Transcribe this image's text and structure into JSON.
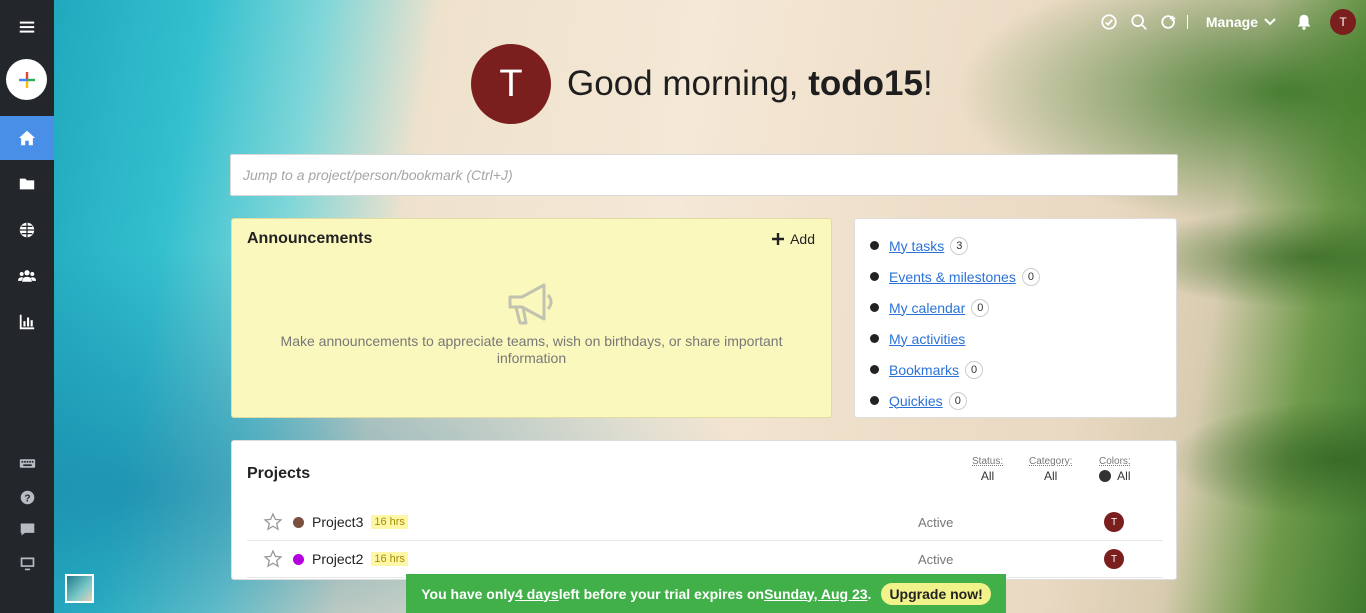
{
  "greeting": {
    "avatar_letter": "T",
    "prefix": "Good morning, ",
    "username": "todo15",
    "suffix": "!"
  },
  "topbar": {
    "manage_label": "Manage",
    "avatar_letter": "T"
  },
  "search": {
    "placeholder": "Jump to a project/person/bookmark (Ctrl+J)"
  },
  "announcements": {
    "title": "Announcements",
    "add_label": "Add",
    "empty_message": "Make announcements to appreciate teams, wish on birthdays, or share important information"
  },
  "quick_links": [
    {
      "label": "My tasks",
      "count": "3"
    },
    {
      "label": "Events & milestones",
      "count": "0"
    },
    {
      "label": "My calendar",
      "count": "0"
    },
    {
      "label": "My activities",
      "count": null
    },
    {
      "label": "Bookmarks",
      "count": "0"
    },
    {
      "label": "Quickies",
      "count": "0"
    }
  ],
  "projects": {
    "title": "Projects",
    "filters": {
      "status_label": "Status:",
      "status_value": "All",
      "category_label": "Category:",
      "category_value": "All",
      "colors_label": "Colors:",
      "colors_value": "All"
    },
    "rows": [
      {
        "name": "Project3",
        "hours": "16 hrs",
        "status": "Active",
        "owner": "T",
        "color": "#7a5040"
      },
      {
        "name": "Project2",
        "hours": "16 hrs",
        "status": "Active",
        "owner": "T",
        "color": "#b400e0"
      }
    ]
  },
  "trial": {
    "text1": "You have only ",
    "days": "4 days",
    "text2": " left before your trial expires on ",
    "date": "Sunday, Aug 23",
    "text3": ".",
    "upgrade_label": "Upgrade now!"
  },
  "colors": {
    "sidebar": "#23262b",
    "active": "#4a8fe7",
    "avatar": "#7b1e1e",
    "trial": "#41b049",
    "link": "#2b72d7"
  }
}
